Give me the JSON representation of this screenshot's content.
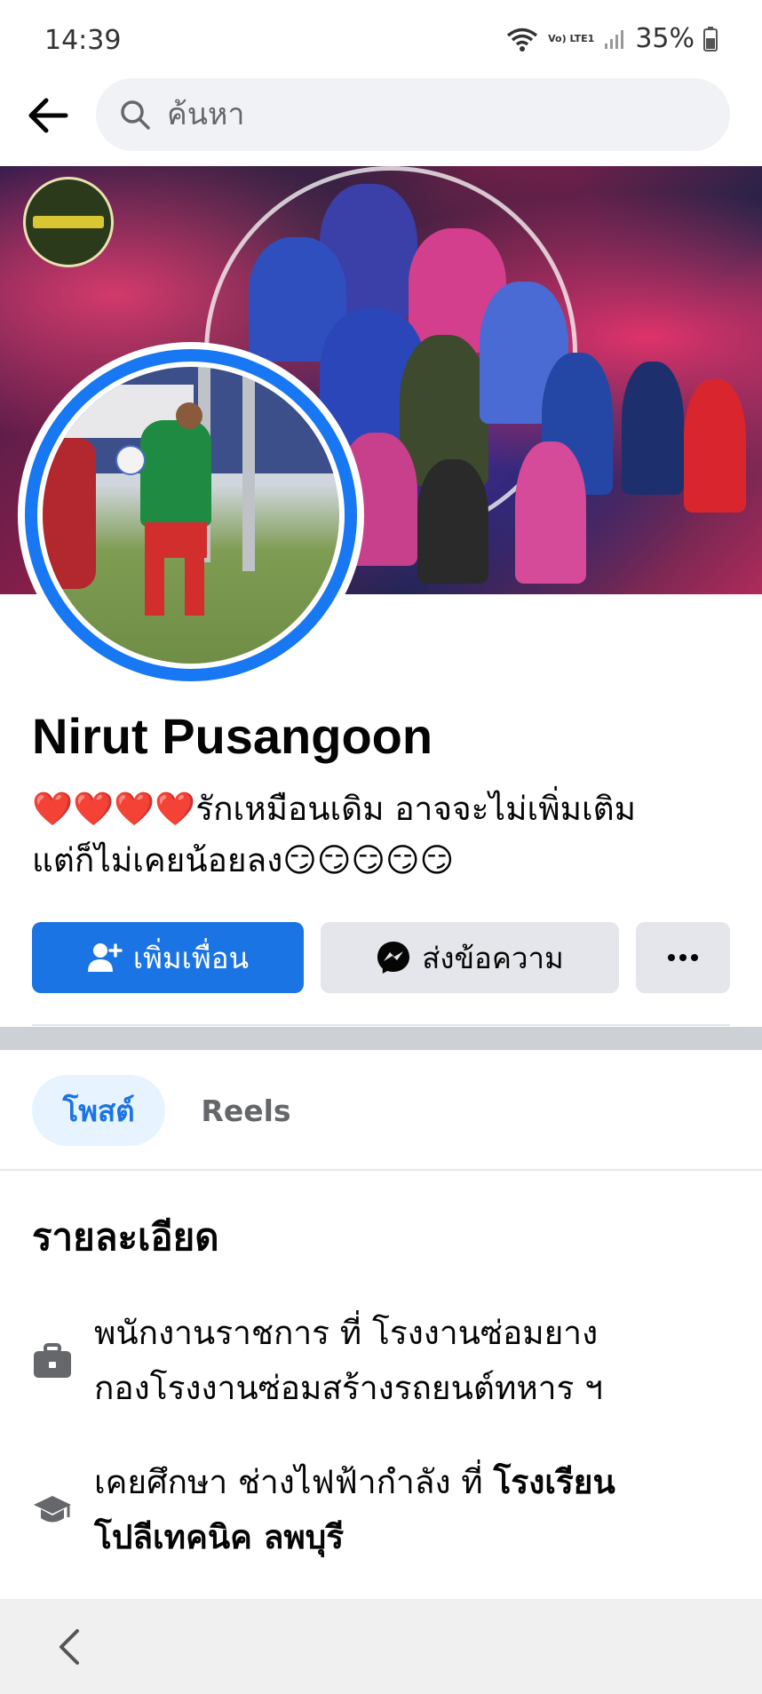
{
  "status_bar": {
    "time": "14:39",
    "network_label": "Vo) LTE1",
    "battery": "35%",
    "icons": [
      "wifi-icon",
      "signal-icon",
      "battery-icon"
    ]
  },
  "top_bar": {
    "search_placeholder": "ค้นหา",
    "icons": [
      "back-arrow-icon",
      "search-icon"
    ]
  },
  "profile": {
    "name": "Nirut Pusangoon",
    "bio_line1": "❤️❤️❤️❤️รักเหมือนเดิม อาจจะไม่เพิ่มเติม",
    "bio_line2": "แต่ก็ไม่เคยน้อยลง😏😏😏😏😏",
    "accent_color": "#1b74e4"
  },
  "actions": {
    "add_friend": "เพิ่มเพื่อน",
    "message": "ส่งข้อความ",
    "more": "···"
  },
  "tabs": [
    {
      "label": "โพสต์",
      "active": true
    },
    {
      "label": "Reels",
      "active": false
    }
  ],
  "details": {
    "title": "รายละเอียด",
    "work": {
      "icon": "briefcase-icon",
      "line1": "พนักงานราชการ ที่ โรงงานซ่อมยาง",
      "line2": "กองโรงงานซ่อมสร้างรถยนต์ทหาร ฯ"
    },
    "education": {
      "icon": "graduation-cap-icon",
      "prefix": "เคยศึกษา ช่างไฟฟ้ากำลัง ที่ ",
      "school_part1": "โรงเรียน",
      "school_part2": "โปลีเทคนิค ลพบุรี"
    }
  },
  "nav_bar": {
    "icons": [
      "nav-back-icon"
    ]
  }
}
